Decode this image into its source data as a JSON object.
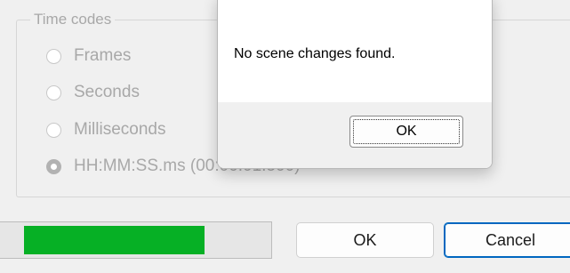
{
  "dialog": {
    "time_codes": {
      "title": "Time codes",
      "options": [
        {
          "label": "Frames",
          "checked": false
        },
        {
          "label": "Seconds",
          "checked": false
        },
        {
          "label": "Milliseconds",
          "checked": false
        },
        {
          "label": "HH:MM:SS.ms (00:00:01.500)",
          "checked": true
        }
      ]
    },
    "progress": {
      "value_percent": 0.74,
      "color": "#06b025"
    },
    "ok_label": "OK",
    "cancel_label": "Cancel",
    "accent_color": "#0067c0"
  },
  "message_box": {
    "text": "No scene changes found.",
    "ok_label": "OK"
  }
}
